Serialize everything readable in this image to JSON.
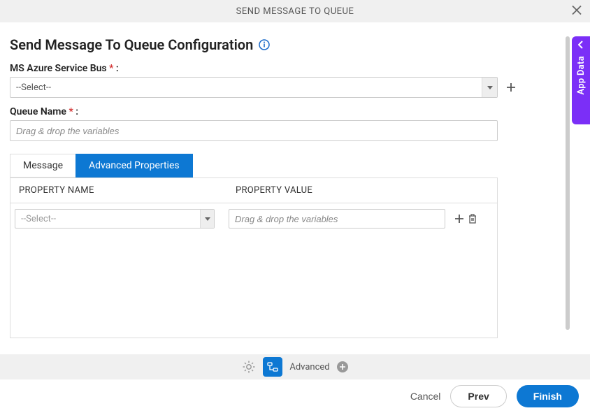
{
  "header": {
    "title": "SEND MESSAGE TO QUEUE"
  },
  "page": {
    "title": "Send Message To Queue Configuration"
  },
  "form": {
    "serviceBus": {
      "label": "MS Azure Service Bus",
      "required": "*",
      "colon": ":",
      "value": "--Select--"
    },
    "queueName": {
      "label": "Queue Name",
      "required": "*",
      "colon": ":",
      "placeholder": "Drag & drop the variables"
    }
  },
  "tabs": {
    "message": "Message",
    "advanced": "Advanced Properties"
  },
  "propsTable": {
    "colName": "PROPERTY NAME",
    "colValue": "PROPERTY VALUE",
    "row": {
      "selectValue": "--Select--",
      "valuePlaceholder": "Drag & drop the variables"
    }
  },
  "midbar": {
    "advancedLabel": "Advanced"
  },
  "footer": {
    "cancel": "Cancel",
    "prev": "Prev",
    "finish": "Finish"
  },
  "sideTab": {
    "label": "App Data"
  }
}
